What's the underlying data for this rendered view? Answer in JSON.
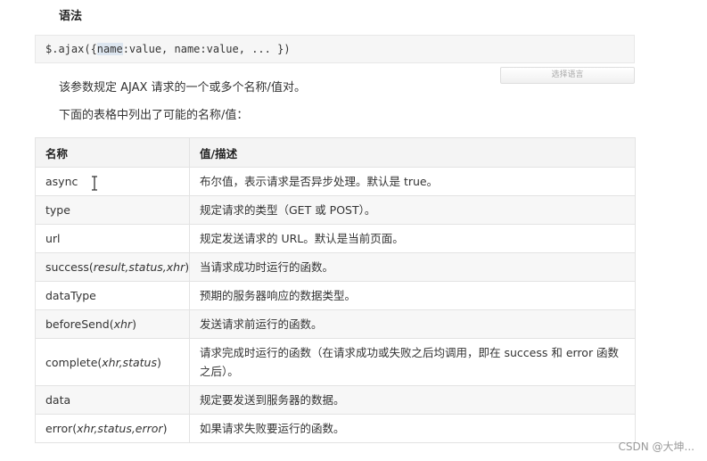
{
  "heading": "语法",
  "code": {
    "prefix": "$.ajax({",
    "highlight": "name",
    "suffix": ":value, name:value, ... })"
  },
  "lang_button": "选择语言",
  "para1": "该参数规定 AJAX 请求的一个或多个名称/值对。",
  "para2": "下面的表格中列出了可能的名称/值：",
  "table": {
    "headers": [
      "名称",
      "值/描述"
    ],
    "rows": [
      {
        "name": [
          {
            "t": "async"
          }
        ],
        "desc": "布尔值，表示请求是否异步处理。默认是 true。"
      },
      {
        "name": [
          {
            "t": "type"
          }
        ],
        "desc": "规定请求的类型（GET 或 POST）。"
      },
      {
        "name": [
          {
            "t": "url"
          }
        ],
        "desc": "规定发送请求的 URL。默认是当前页面。"
      },
      {
        "name": [
          {
            "t": "success("
          },
          {
            "t": "result,status,xhr",
            "i": true
          },
          {
            "t": ")"
          }
        ],
        "desc": "当请求成功时运行的函数。"
      },
      {
        "name": [
          {
            "t": "dataType"
          }
        ],
        "desc": "预期的服务器响应的数据类型。"
      },
      {
        "name": [
          {
            "t": "beforeSend("
          },
          {
            "t": "xhr",
            "i": true
          },
          {
            "t": ")"
          }
        ],
        "desc": "发送请求前运行的函数。"
      },
      {
        "name": [
          {
            "t": "complete("
          },
          {
            "t": "xhr,status",
            "i": true
          },
          {
            "t": ")"
          }
        ],
        "desc": "请求完成时运行的函数（在请求成功或失败之后均调用，即在 success 和 error 函数之后）。",
        "tall": true
      },
      {
        "name": [
          {
            "t": "data"
          }
        ],
        "desc": "规定要发送到服务器的数据。"
      },
      {
        "name": [
          {
            "t": "error("
          },
          {
            "t": "xhr,status,error",
            "i": true
          },
          {
            "t": ")"
          }
        ],
        "desc": "如果请求失败要运行的函数。"
      }
    ]
  },
  "watermark": "CSDN @大坤..."
}
